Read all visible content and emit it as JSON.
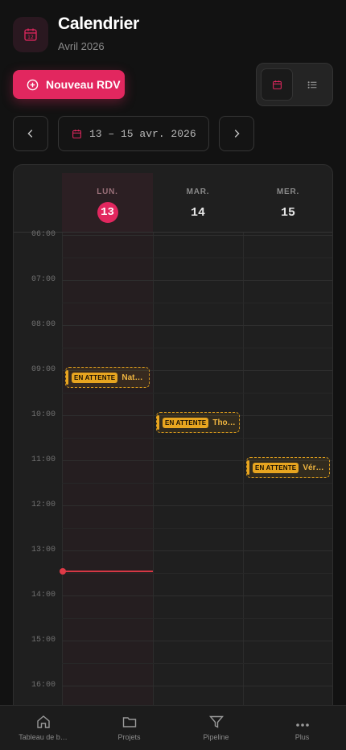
{
  "header": {
    "title": "Calendrier",
    "subtitle": "Avril 2026",
    "icon": "calendar-icon"
  },
  "actions": {
    "new_label": "Nouveau RDV"
  },
  "view_toggle": {
    "active": "calendar",
    "options": [
      "calendar",
      "list"
    ]
  },
  "range": {
    "label": "13 – 15 avr. 2026"
  },
  "days": [
    {
      "dow": "LUN.",
      "num": "13",
      "today": true
    },
    {
      "dow": "MAR.",
      "num": "14",
      "today": false
    },
    {
      "dow": "MER.",
      "num": "15",
      "today": false
    }
  ],
  "hours": [
    "06:00",
    "07:00",
    "08:00",
    "09:00",
    "10:00",
    "11:00",
    "12:00",
    "13:00",
    "14:00",
    "15:00",
    "16:00"
  ],
  "events": [
    {
      "day": 0,
      "hour": 9,
      "badge": "EN ATTENTE",
      "name": "Nat…"
    },
    {
      "day": 1,
      "hour": 10,
      "badge": "EN ATTENTE",
      "name": "Tho…"
    },
    {
      "day": 2,
      "hour": 11,
      "badge": "EN ATTENTE",
      "name": "Vér…"
    }
  ],
  "now_time": "13:30",
  "bottom_nav": [
    {
      "label": "Tableau de b…",
      "icon": "home-icon"
    },
    {
      "label": "Projets",
      "icon": "folder-icon"
    },
    {
      "label": "Pipeline",
      "icon": "filter-icon"
    },
    {
      "label": "Plus",
      "icon": "more-icon"
    }
  ],
  "colors": {
    "accent": "#e2275f",
    "pending": "#e7a520",
    "now_line": "#d63845"
  }
}
